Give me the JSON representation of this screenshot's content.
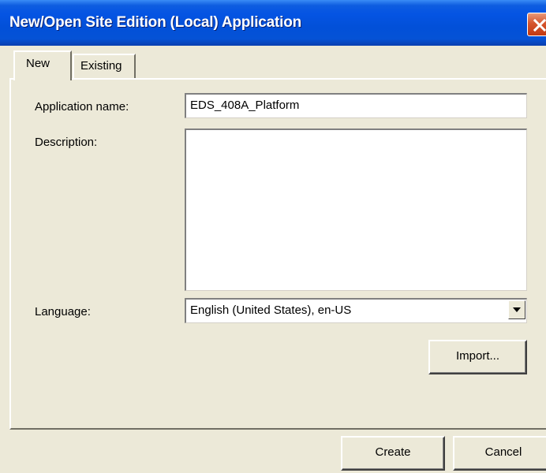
{
  "window": {
    "title": "New/Open Site Edition (Local) Application",
    "close_icon": "close-icon",
    "close_color": "#D5552E"
  },
  "tabs": [
    {
      "label": "New",
      "selected": true
    },
    {
      "label": "Existing",
      "selected": false
    }
  ],
  "form": {
    "app_name_label": "Application name:",
    "app_name_value": "EDS_408A_Platform",
    "description_label": "Description:",
    "description_value": "",
    "language_label": "Language:",
    "language_value": "English (United States), en-US",
    "import_label": "Import..."
  },
  "footer": {
    "create_label": "Create",
    "cancel_label": "Cancel"
  },
  "colors": {
    "titlebar": "#0554E3",
    "dialog_bg": "#ECE9D8"
  }
}
